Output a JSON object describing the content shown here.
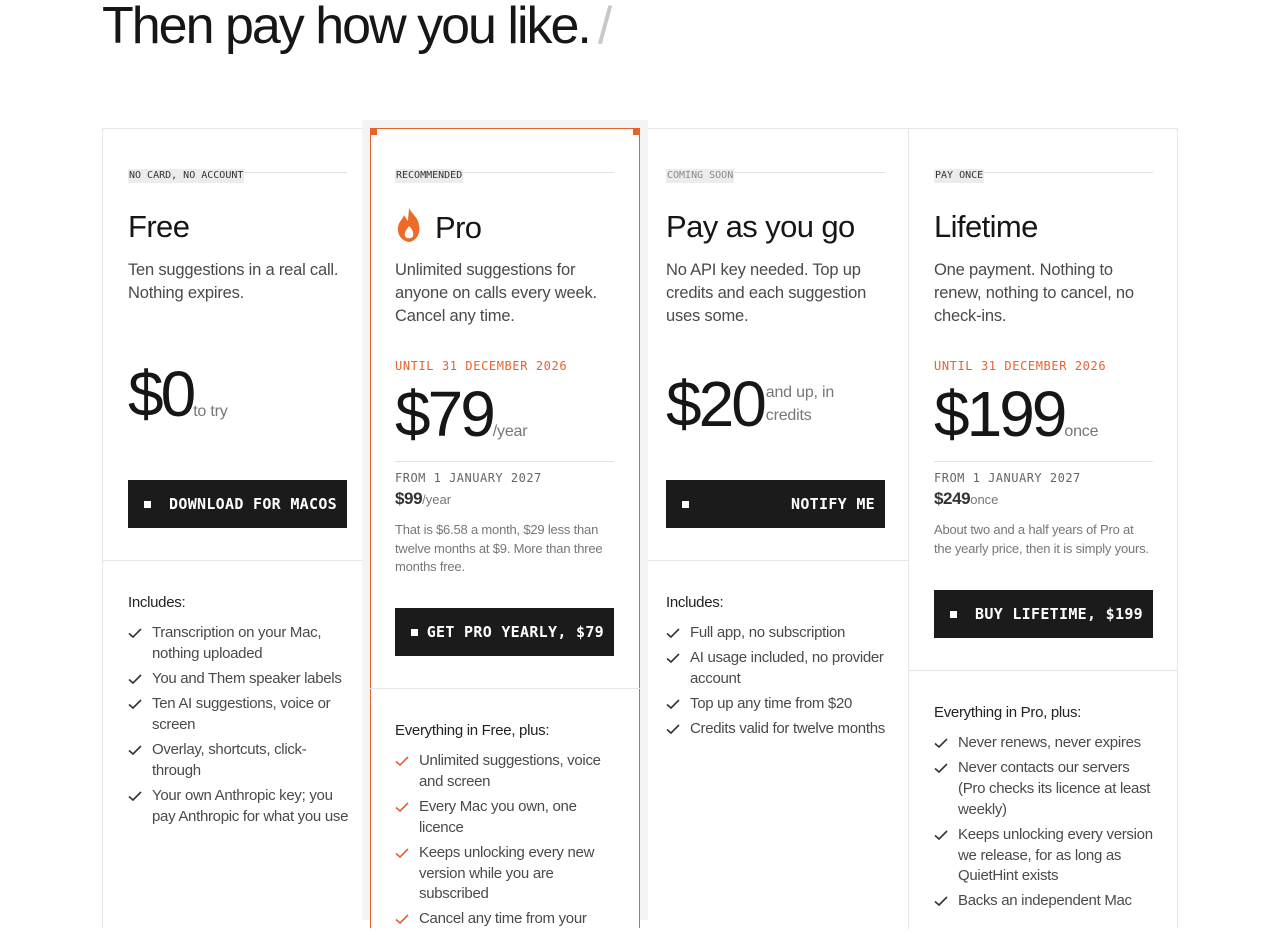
{
  "headline": {
    "text": "Then pay how you like.",
    "cursor": "/"
  },
  "colors": {
    "accent": "#e8622c",
    "button_bg": "#1b1b1b"
  },
  "plans": [
    {
      "tag": "NO CARD, NO ACCOUNT",
      "name": "Free",
      "description": "Ten suggestions in a real call. Nothing expires.",
      "price": "$0",
      "price_suffix": "to try",
      "button": "DOWNLOAD FOR MACOS",
      "includes_title": "Includes:",
      "features": [
        "Transcription on your Mac, nothing uploaded",
        "You and Them speaker labels",
        "Ten AI suggestions, voice or screen",
        "Overlay, shortcuts, click-through",
        "Your own Anthropic key; you pay Anthropic for what you use"
      ]
    },
    {
      "tag": "RECOMMENDED",
      "icon": "flame-icon",
      "name": "Pro",
      "description": "Unlimited suggestions for anyone on calls every week. Cancel any time.",
      "until": "UNTIL 31 DECEMBER 2026",
      "price": "$79",
      "price_suffix": "/year",
      "from": "FROM 1 JANUARY 2027",
      "later_price": "$99",
      "later_suffix": "/year",
      "note": "That is $6.58 a month, $29 less than twelve months at $9. More than three months free.",
      "button": "GET PRO YEARLY, $79",
      "includes_title": "Everything in Free, plus:",
      "features": [
        "Unlimited suggestions, voice and screen",
        "Every Mac you own, one licence",
        "Keeps unlocking every new version while you are subscribed",
        "Cancel any time from your"
      ]
    },
    {
      "tag": "COMING SOON",
      "name": "Pay as you go",
      "description": "No API key needed. Top up credits and each suggestion uses some.",
      "price": "$20",
      "price_suffix": "and up, in credits",
      "button": "NOTIFY ME",
      "includes_title": "Includes:",
      "features": [
        "Full app, no subscription",
        "AI usage included, no provider account",
        "Top up any time from $20",
        "Credits valid for twelve months"
      ]
    },
    {
      "tag": "PAY ONCE",
      "name": "Lifetime",
      "description": "One payment. Nothing to renew, nothing to cancel, no check-ins.",
      "until": "UNTIL 31 DECEMBER 2026",
      "price": "$199",
      "price_suffix": "once",
      "from": "FROM 1 JANUARY 2027",
      "later_price": "$249",
      "later_suffix": "once",
      "note": "About two and a half years of Pro at the yearly price, then it is simply yours.",
      "button": "BUY LIFETIME, $199",
      "includes_title": "Everything in Pro, plus:",
      "features": [
        "Never renews, never expires",
        "Never contacts our servers (Pro checks its licence at least weekly)",
        "Keeps unlocking every version we release, for as long as QuietHint exists",
        "Backs an independent Mac"
      ]
    }
  ]
}
